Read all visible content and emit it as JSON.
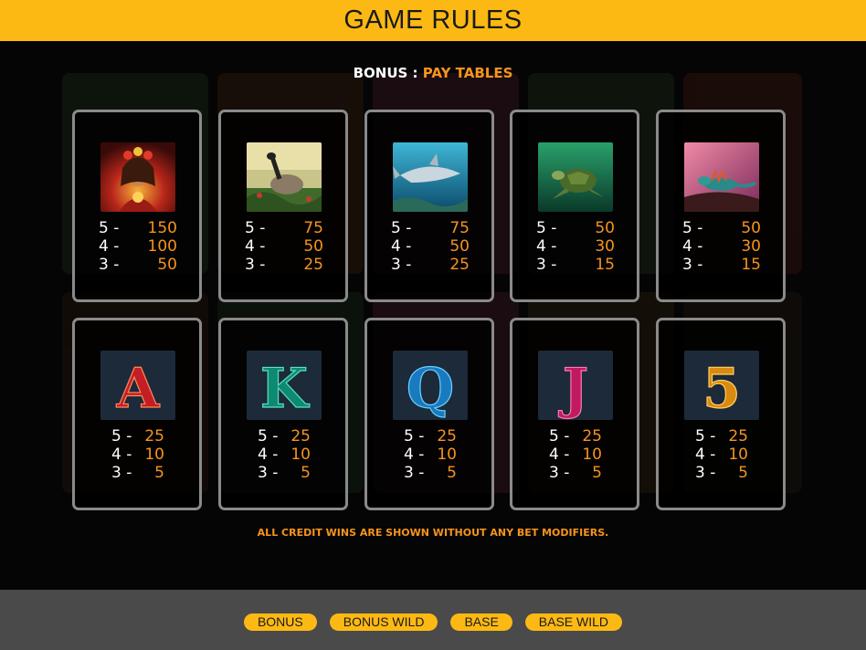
{
  "header": {
    "title": "GAME RULES"
  },
  "section": {
    "prefix": "BONUS :",
    "title": "PAY TABLES"
  },
  "cards": [
    {
      "symbol": "goddess-symbol",
      "pays": [
        {
          "count": "5 -",
          "value": "150"
        },
        {
          "count": "4 -",
          "value": "100"
        },
        {
          "count": "3 -",
          "value": "50"
        }
      ]
    },
    {
      "symbol": "nene-goose-symbol",
      "pays": [
        {
          "count": "5 -",
          "value": "75"
        },
        {
          "count": "4 -",
          "value": "50"
        },
        {
          "count": "3 -",
          "value": "25"
        }
      ]
    },
    {
      "symbol": "shark-symbol",
      "pays": [
        {
          "count": "5 -",
          "value": "75"
        },
        {
          "count": "4 -",
          "value": "50"
        },
        {
          "count": "3 -",
          "value": "25"
        }
      ]
    },
    {
      "symbol": "sea-turtle-symbol",
      "pays": [
        {
          "count": "5 -",
          "value": "50"
        },
        {
          "count": "4 -",
          "value": "30"
        },
        {
          "count": "3 -",
          "value": "15"
        }
      ]
    },
    {
      "symbol": "lizard-symbol",
      "pays": [
        {
          "count": "5 -",
          "value": "50"
        },
        {
          "count": "4 -",
          "value": "30"
        },
        {
          "count": "3 -",
          "value": "15"
        }
      ]
    },
    {
      "symbol": "letter-a-symbol",
      "letter": "A",
      "color": "#d8262b",
      "pays": [
        {
          "count": "5 -",
          "value": "25"
        },
        {
          "count": "4 -",
          "value": "10"
        },
        {
          "count": "3 -",
          "value": "5"
        }
      ]
    },
    {
      "symbol": "letter-k-symbol",
      "letter": "K",
      "color": "#1fa88e",
      "pays": [
        {
          "count": "5 -",
          "value": "25"
        },
        {
          "count": "4 -",
          "value": "10"
        },
        {
          "count": "3 -",
          "value": "5"
        }
      ]
    },
    {
      "symbol": "letter-q-symbol",
      "letter": "Q",
      "color": "#2b9fe0",
      "pays": [
        {
          "count": "5 -",
          "value": "25"
        },
        {
          "count": "4 -",
          "value": "10"
        },
        {
          "count": "3 -",
          "value": "5"
        }
      ]
    },
    {
      "symbol": "letter-j-symbol",
      "letter": "J",
      "color": "#e0307a",
      "pays": [
        {
          "count": "5 -",
          "value": "25"
        },
        {
          "count": "4 -",
          "value": "10"
        },
        {
          "count": "3 -",
          "value": "5"
        }
      ]
    },
    {
      "symbol": "number-5-symbol",
      "letter": "5",
      "color": "#f2a51c",
      "pays": [
        {
          "count": "5 -",
          "value": "25"
        },
        {
          "count": "4 -",
          "value": "10"
        },
        {
          "count": "3 -",
          "value": "5"
        }
      ]
    }
  ],
  "note": "ALL CREDIT WINS ARE SHOWN WITHOUT ANY BET MODIFIERS.",
  "nav": [
    "BONUS",
    "BONUS WILD",
    "BASE",
    "BASE WILD"
  ],
  "colors": {
    "accent": "#fdb913",
    "value_orange": "#f7941d",
    "card_border": "#8a8a8a",
    "footer_bg": "#4a4a4a"
  }
}
